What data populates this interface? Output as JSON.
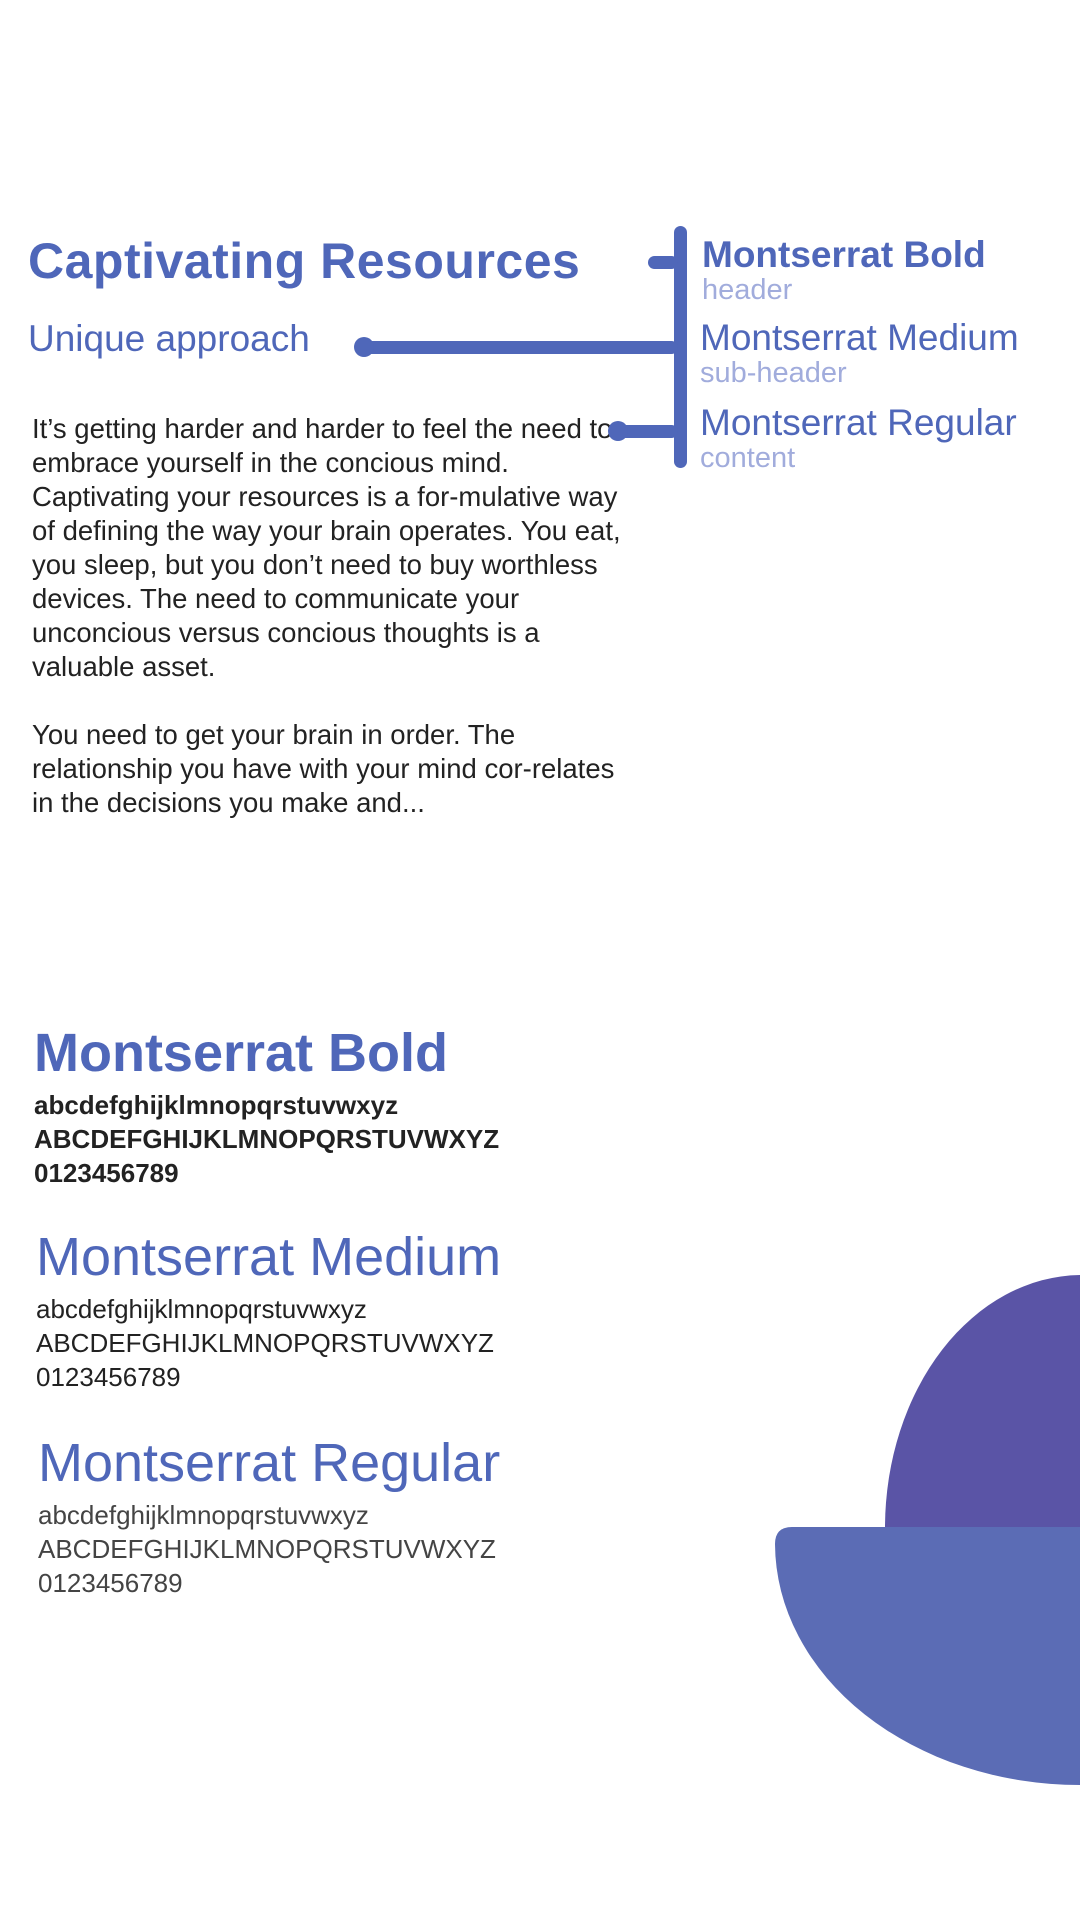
{
  "header": {
    "title": "Captivating Resources",
    "subtitle": "Unique approach"
  },
  "body": {
    "paragraphs": [
      "It’s getting harder and harder to feel the need to embrace yourself in the concious mind. Captivating your resources is a for-mulative way of defining the way your brain operates. You eat, you sleep, but you don’t need to buy worthless devices. The need to communicate your unconcious versus concious thoughts is a valuable asset.",
      "You need to get your brain in order. The relationship you have with your mind cor-relates in the decisions you make and..."
    ]
  },
  "legend": [
    {
      "font": "Montserrat Bold",
      "role": "header"
    },
    {
      "font": "Montserrat Medium",
      "role": "sub-header"
    },
    {
      "font": "Montserrat Regular",
      "role": "content"
    }
  ],
  "specimens": [
    {
      "title": "Montserrat Bold",
      "lower": "abcdefghijklmnopqrstuvwxyz",
      "upper": "ABCDEFGHIJKLMNOPQRSTUVWXYZ",
      "digits": "0123456789"
    },
    {
      "title": "Montserrat Medium",
      "lower": "abcdefghijklmnopqrstuvwxyz",
      "upper": "ABCDEFGHIJKLMNOPQRSTUVWXYZ",
      "digits": "0123456789"
    },
    {
      "title": "Montserrat Regular",
      "lower": "abcdefghijklmnopqrstuvwxyz",
      "upper": "ABCDEFGHIJKLMNOPQRSTUVWXYZ",
      "digits": "0123456789"
    }
  ],
  "colors": {
    "accent": "#4f67b9",
    "accent_light": "#a1acdc",
    "shape_top": "#5a54a6",
    "shape_bottom": "#5b6cb5",
    "text": "#222222"
  }
}
